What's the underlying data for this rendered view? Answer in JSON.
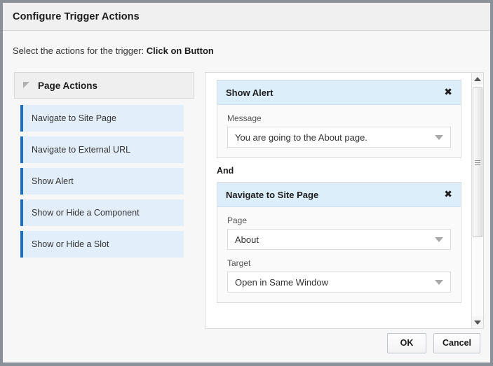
{
  "dialog": {
    "title": "Configure Trigger Actions",
    "prompt_prefix": "Select the actions for the trigger:",
    "trigger_name": "Click on Button"
  },
  "left_panel": {
    "accordion": {
      "title": "Page Actions",
      "disclosure_icon": "triangle-expanded-icon",
      "expanded": true
    },
    "items": [
      {
        "label": "Navigate to Site Page"
      },
      {
        "label": "Navigate to External URL"
      },
      {
        "label": "Show Alert"
      },
      {
        "label": "Show or Hide a Component"
      },
      {
        "label": "Show or Hide a Slot"
      }
    ]
  },
  "right_panel": {
    "separator_label": "And",
    "close_icon": "✖",
    "cards": [
      {
        "title": "Show Alert",
        "fields": [
          {
            "label": "Message",
            "value": "You are going to the About page.",
            "arrow_icon": "chevron-down-icon"
          }
        ]
      },
      {
        "title": "Navigate to Site Page",
        "fields": [
          {
            "label": "Page",
            "value": "About",
            "arrow_icon": "chevron-down-icon"
          },
          {
            "label": "Target",
            "value": "Open in Same Window",
            "arrow_icon": "chevron-down-icon"
          }
        ]
      }
    ],
    "scrollbar": {
      "up_icon": "scroll-up-arrow-icon",
      "down_icon": "scroll-down-arrow-icon",
      "thumb_grip_icon": "scroll-thumb-grip-icon"
    }
  },
  "footer": {
    "ok_label": "OK",
    "cancel_label": "Cancel"
  },
  "colors": {
    "accent_blue": "#1a71c4",
    "item_background": "#e2eefa",
    "card_header": "#ddeefb",
    "dialog_border": "#8a9199",
    "body_background": "#f7f7f7"
  }
}
